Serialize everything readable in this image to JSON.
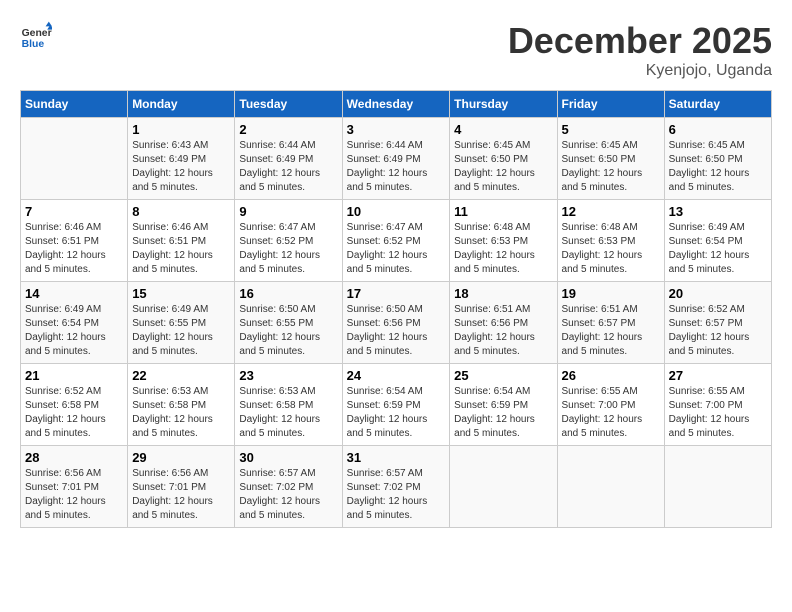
{
  "logo": {
    "line1": "General",
    "line2": "Blue"
  },
  "title": "December 2025",
  "subtitle": "Kyenjojo, Uganda",
  "days_header": [
    "Sunday",
    "Monday",
    "Tuesday",
    "Wednesday",
    "Thursday",
    "Friday",
    "Saturday"
  ],
  "weeks": [
    [
      {
        "day": "",
        "info": ""
      },
      {
        "day": "1",
        "info": "Sunrise: 6:43 AM\nSunset: 6:49 PM\nDaylight: 12 hours and 5 minutes."
      },
      {
        "day": "2",
        "info": "Sunrise: 6:44 AM\nSunset: 6:49 PM\nDaylight: 12 hours and 5 minutes."
      },
      {
        "day": "3",
        "info": "Sunrise: 6:44 AM\nSunset: 6:49 PM\nDaylight: 12 hours and 5 minutes."
      },
      {
        "day": "4",
        "info": "Sunrise: 6:45 AM\nSunset: 6:50 PM\nDaylight: 12 hours and 5 minutes."
      },
      {
        "day": "5",
        "info": "Sunrise: 6:45 AM\nSunset: 6:50 PM\nDaylight: 12 hours and 5 minutes."
      },
      {
        "day": "6",
        "info": "Sunrise: 6:45 AM\nSunset: 6:50 PM\nDaylight: 12 hours and 5 minutes."
      }
    ],
    [
      {
        "day": "7",
        "info": "Sunrise: 6:46 AM\nSunset: 6:51 PM\nDaylight: 12 hours and 5 minutes."
      },
      {
        "day": "8",
        "info": "Sunrise: 6:46 AM\nSunset: 6:51 PM\nDaylight: 12 hours and 5 minutes."
      },
      {
        "day": "9",
        "info": "Sunrise: 6:47 AM\nSunset: 6:52 PM\nDaylight: 12 hours and 5 minutes."
      },
      {
        "day": "10",
        "info": "Sunrise: 6:47 AM\nSunset: 6:52 PM\nDaylight: 12 hours and 5 minutes."
      },
      {
        "day": "11",
        "info": "Sunrise: 6:48 AM\nSunset: 6:53 PM\nDaylight: 12 hours and 5 minutes."
      },
      {
        "day": "12",
        "info": "Sunrise: 6:48 AM\nSunset: 6:53 PM\nDaylight: 12 hours and 5 minutes."
      },
      {
        "day": "13",
        "info": "Sunrise: 6:49 AM\nSunset: 6:54 PM\nDaylight: 12 hours and 5 minutes."
      }
    ],
    [
      {
        "day": "14",
        "info": "Sunrise: 6:49 AM\nSunset: 6:54 PM\nDaylight: 12 hours and 5 minutes."
      },
      {
        "day": "15",
        "info": "Sunrise: 6:49 AM\nSunset: 6:55 PM\nDaylight: 12 hours and 5 minutes."
      },
      {
        "day": "16",
        "info": "Sunrise: 6:50 AM\nSunset: 6:55 PM\nDaylight: 12 hours and 5 minutes."
      },
      {
        "day": "17",
        "info": "Sunrise: 6:50 AM\nSunset: 6:56 PM\nDaylight: 12 hours and 5 minutes."
      },
      {
        "day": "18",
        "info": "Sunrise: 6:51 AM\nSunset: 6:56 PM\nDaylight: 12 hours and 5 minutes."
      },
      {
        "day": "19",
        "info": "Sunrise: 6:51 AM\nSunset: 6:57 PM\nDaylight: 12 hours and 5 minutes."
      },
      {
        "day": "20",
        "info": "Sunrise: 6:52 AM\nSunset: 6:57 PM\nDaylight: 12 hours and 5 minutes."
      }
    ],
    [
      {
        "day": "21",
        "info": "Sunrise: 6:52 AM\nSunset: 6:58 PM\nDaylight: 12 hours and 5 minutes."
      },
      {
        "day": "22",
        "info": "Sunrise: 6:53 AM\nSunset: 6:58 PM\nDaylight: 12 hours and 5 minutes."
      },
      {
        "day": "23",
        "info": "Sunrise: 6:53 AM\nSunset: 6:58 PM\nDaylight: 12 hours and 5 minutes."
      },
      {
        "day": "24",
        "info": "Sunrise: 6:54 AM\nSunset: 6:59 PM\nDaylight: 12 hours and 5 minutes."
      },
      {
        "day": "25",
        "info": "Sunrise: 6:54 AM\nSunset: 6:59 PM\nDaylight: 12 hours and 5 minutes."
      },
      {
        "day": "26",
        "info": "Sunrise: 6:55 AM\nSunset: 7:00 PM\nDaylight: 12 hours and 5 minutes."
      },
      {
        "day": "27",
        "info": "Sunrise: 6:55 AM\nSunset: 7:00 PM\nDaylight: 12 hours and 5 minutes."
      }
    ],
    [
      {
        "day": "28",
        "info": "Sunrise: 6:56 AM\nSunset: 7:01 PM\nDaylight: 12 hours and 5 minutes."
      },
      {
        "day": "29",
        "info": "Sunrise: 6:56 AM\nSunset: 7:01 PM\nDaylight: 12 hours and 5 minutes."
      },
      {
        "day": "30",
        "info": "Sunrise: 6:57 AM\nSunset: 7:02 PM\nDaylight: 12 hours and 5 minutes."
      },
      {
        "day": "31",
        "info": "Sunrise: 6:57 AM\nSunset: 7:02 PM\nDaylight: 12 hours and 5 minutes."
      },
      {
        "day": "",
        "info": ""
      },
      {
        "day": "",
        "info": ""
      },
      {
        "day": "",
        "info": ""
      }
    ]
  ]
}
